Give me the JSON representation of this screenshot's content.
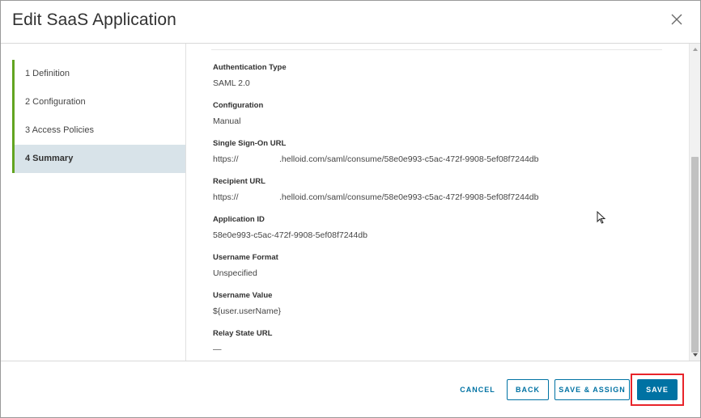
{
  "dialog": {
    "title": "Edit SaaS Application"
  },
  "steps": [
    {
      "label": "1  Definition",
      "active": false
    },
    {
      "label": "2  Configuration",
      "active": false
    },
    {
      "label": "3  Access Policies",
      "active": false
    },
    {
      "label": "4  Summary",
      "active": true
    }
  ],
  "summary": {
    "authentication_type": {
      "label": "Authentication Type",
      "value": "SAML 2.0"
    },
    "configuration": {
      "label": "Configuration",
      "value": "Manual"
    },
    "sso_url": {
      "label": "Single Sign-On URL",
      "prefix": "https://",
      "value": ".helloid.com/saml/consume/58e0e993-c5ac-472f-9908-5ef08f7244db"
    },
    "recipient_url": {
      "label": "Recipient URL",
      "prefix": "https://",
      "value": ".helloid.com/saml/consume/58e0e993-c5ac-472f-9908-5ef08f7244db"
    },
    "application_id": {
      "label": "Application ID",
      "value": "58e0e993-c5ac-472f-9908-5ef08f7244db"
    },
    "username_format": {
      "label": "Username Format",
      "value": "Unspecified"
    },
    "username_value": {
      "label": "Username Value",
      "value": "${user.userName}"
    },
    "relay_state_url": {
      "label": "Relay State URL",
      "value": "—"
    }
  },
  "footer": {
    "cancel_label": "CANCEL",
    "back_label": "BACK",
    "save_assign_label": "SAVE & ASSIGN",
    "save_label": "SAVE"
  },
  "colors": {
    "primary": "#0072a3",
    "step_indicator": "#62a420",
    "active_step_bg": "#d8e3e9",
    "highlight": "#e8242a"
  }
}
